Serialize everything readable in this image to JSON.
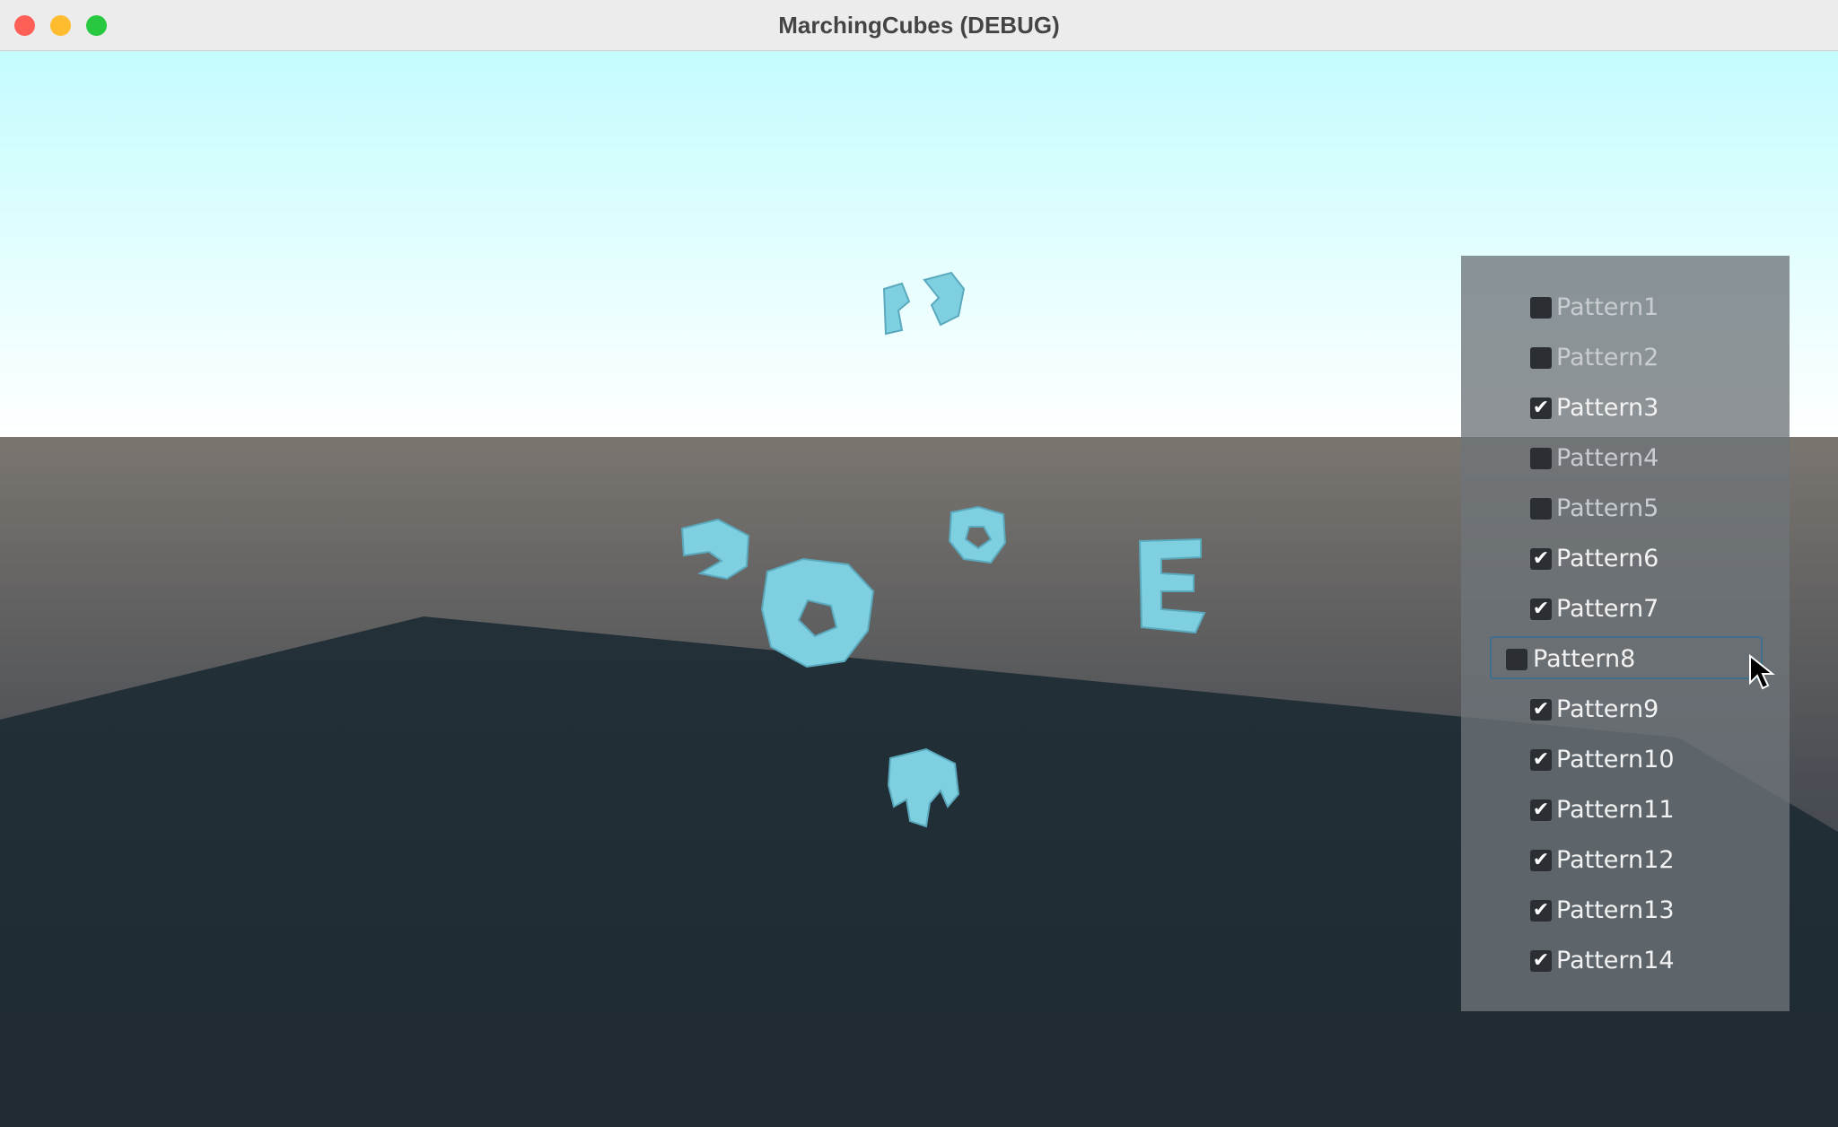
{
  "window": {
    "title": "MarchingCubes (DEBUG)",
    "buttons": [
      "close",
      "minimize",
      "maximize"
    ]
  },
  "colors": {
    "sky_top": "#c4fcfe",
    "sky_horizon": "#ffffff",
    "ground": "#1f2a31",
    "mesh": "#7ecfe0",
    "panel": "#6e747a"
  },
  "patterns": [
    {
      "label": "Pattern1",
      "checked": false
    },
    {
      "label": "Pattern2",
      "checked": false
    },
    {
      "label": "Pattern3",
      "checked": true
    },
    {
      "label": "Pattern4",
      "checked": false
    },
    {
      "label": "Pattern5",
      "checked": false
    },
    {
      "label": "Pattern6",
      "checked": true
    },
    {
      "label": "Pattern7",
      "checked": true
    },
    {
      "label": "Pattern8",
      "checked": false,
      "focused": true
    },
    {
      "label": "Pattern9",
      "checked": true
    },
    {
      "label": "Pattern10",
      "checked": true
    },
    {
      "label": "Pattern11",
      "checked": true
    },
    {
      "label": "Pattern12",
      "checked": true
    },
    {
      "label": "Pattern13",
      "checked": true
    },
    {
      "label": "Pattern14",
      "checked": true
    }
  ]
}
